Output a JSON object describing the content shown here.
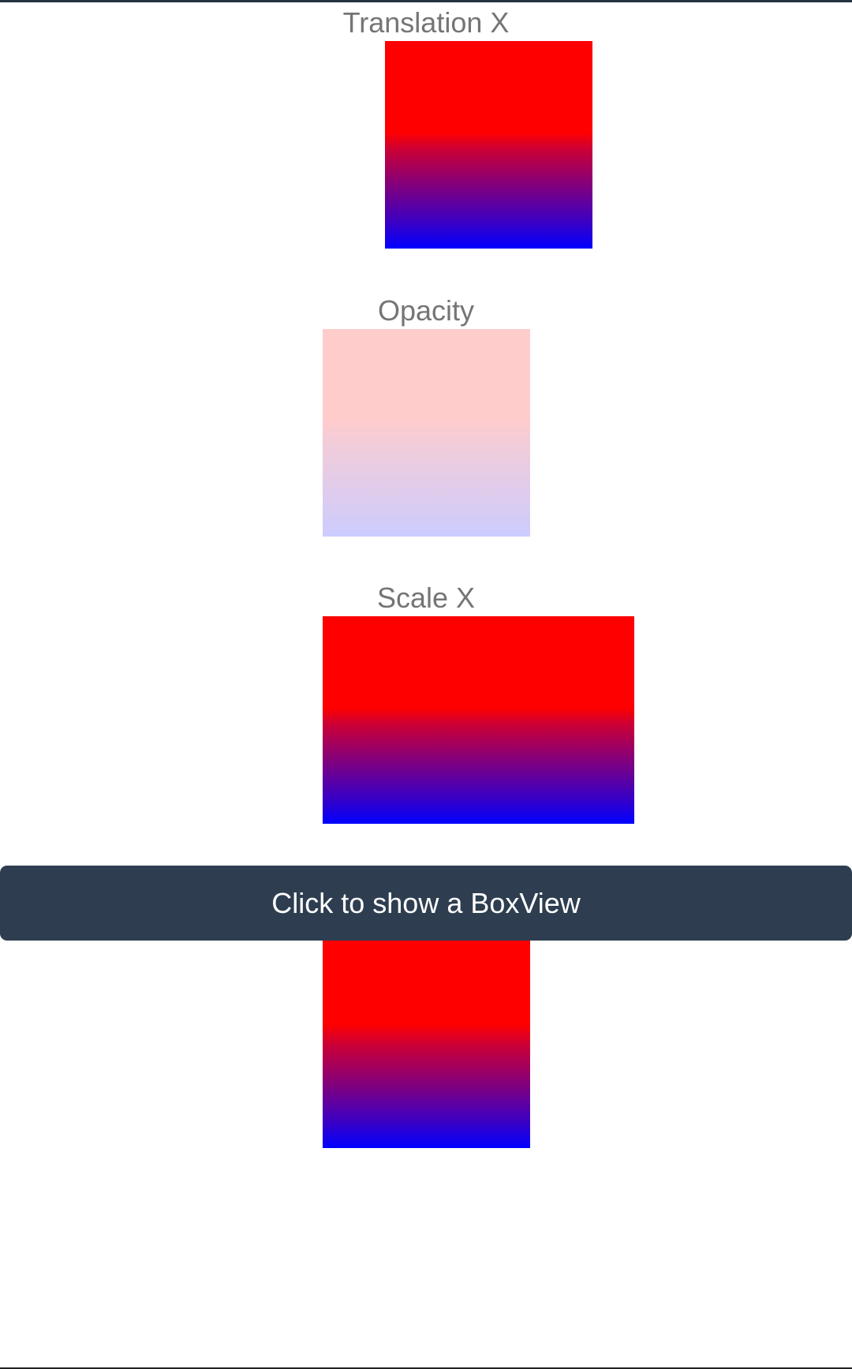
{
  "sections": {
    "translation": {
      "label": "Translation X"
    },
    "opacity": {
      "label": "Opacity"
    },
    "scale": {
      "label": "Scale X"
    }
  },
  "button": {
    "label": "Click to show a BoxView"
  },
  "colors": {
    "gradient_top": "#ff0000",
    "gradient_bottom": "#0000ff",
    "button_background": "#2e3e50",
    "label_text": "#757575"
  }
}
